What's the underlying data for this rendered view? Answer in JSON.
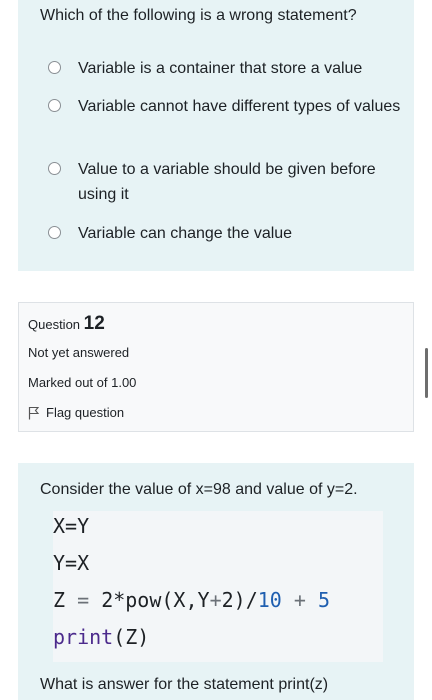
{
  "question_prev": {
    "text": "Which of the following is a wrong statement?",
    "options": [
      "Variable is a container that store a value",
      "Variable cannot have different types of values",
      "Value to a variable should be given before using it",
      "Variable can change the value"
    ]
  },
  "question_info": {
    "label": "Question",
    "number": "12",
    "status": "Not yet answered",
    "marked": "Marked out of 1.00",
    "flag": "Flag question"
  },
  "question_12": {
    "prompt": "Consider the value of x=98 and value of y=2.",
    "code": {
      "line1": "X=Y",
      "line2": "Y=X",
      "line3_lhs": "Z",
      "line3_eq": "=",
      "line3_a": "2*pow(X,Y",
      "line3_plus": "+",
      "line3_b": "2)/",
      "line3_num10": "10",
      "line3_plus2": "+",
      "line3_num5": "5",
      "line4_fn": "print",
      "line4_arg": "(Z)"
    },
    "followup": "What is answer for the statement print(z)"
  }
}
